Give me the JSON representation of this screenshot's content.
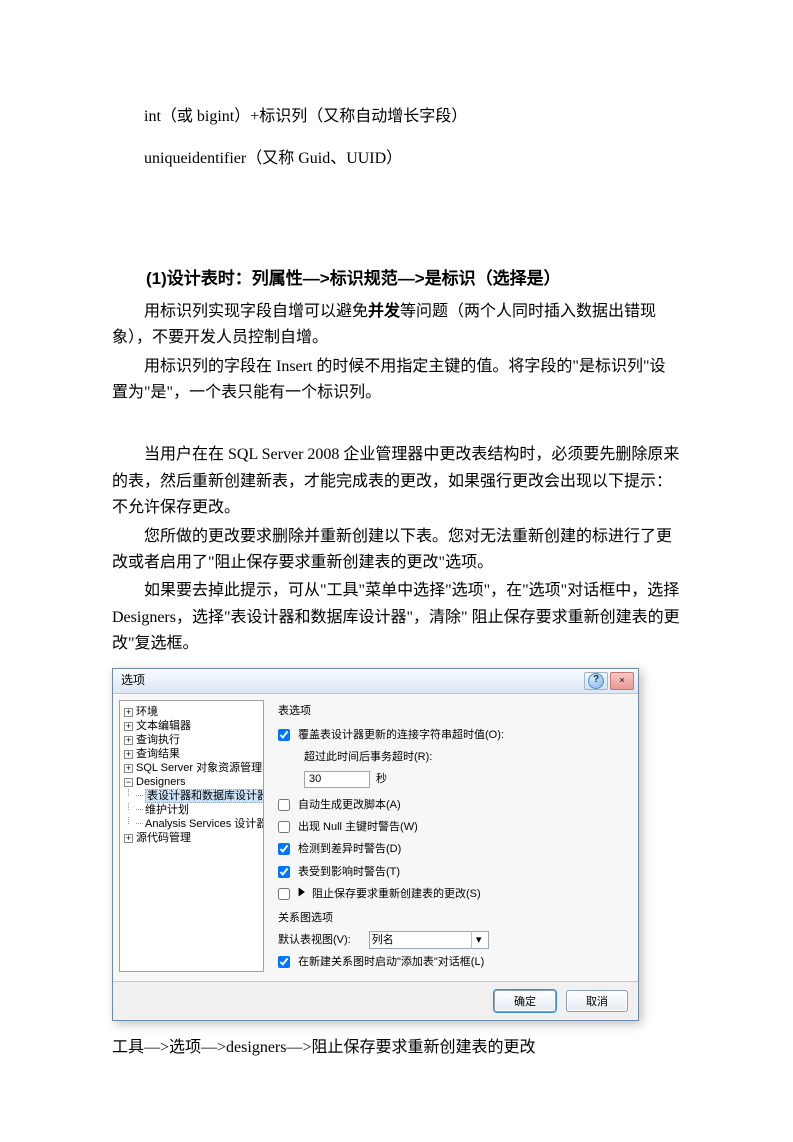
{
  "text": {
    "line1": "int（或 bigint）+标识列（又称自动增长字段）",
    "line2": "uniqueidentifier（又称 Guid、UUID）",
    "heading": "(1)设计表时：列属性—>标识规范—>是标识（选择是）",
    "p1_a": "用标识列实现字段自增可以避免",
    "p1_bold": "并发",
    "p1_b": "等问题（两个人同时插入数据出错现象），不要开发人员控制自增。",
    "p2": "用标识列的字段在 Insert 的时候不用指定主键的值。将字段的\"是标识列\"设置为\"是\"，一个表只能有一个标识列。",
    "p3": "当用户在在 SQL Server 2008 企业管理器中更改表结构时，必须要先删除原来的表，然后重新创建新表，才能完成表的更改，如果强行更改会出现以下提示：不允许保存更改。",
    "p4": "您所做的更改要求删除并重新创建以下表。您对无法重新创建的标进行了更改或者启用了\"阻止保存要求重新创建表的更改\"选项。",
    "p5": "如果要去掉此提示，可从\"工具\"菜单中选择\"选项\"，在\"选项\"对话框中，选择 Designers，选择\"表设计器和数据库设计器\"，清除\" 阻止保存要求重新创建表的更改\"复选框。",
    "caption": "工具—>选项—>designers—>阻止保存要求重新创建表的更改"
  },
  "dialog": {
    "title": "选项",
    "help": "?",
    "close": "×",
    "tree": {
      "n0": "环境",
      "n1": "文本编辑器",
      "n2": "查询执行",
      "n3": "查询结果",
      "n4": "SQL Server 对象资源管理器",
      "n5": "Designers",
      "n5a": "表设计器和数据库设计器",
      "n5b": "维护计划",
      "n5c": "Analysis Services 设计器",
      "n6": "源代码管理"
    },
    "opts": {
      "section": "表选项",
      "cb_override": "覆盖表设计器更新的连接字符串超时值(O):",
      "timeout_label": "超过此时间后事务超时(R):",
      "timeout_value": "30",
      "timeout_unit": "秒",
      "cb_autoscript": "自动生成更改脚本(A)",
      "cb_nullpk": "出现 Null 主键时警告(W)",
      "cb_diff": "检测到差异时警告(D)",
      "cb_affected": "表受到影响时警告(T)",
      "cb_prevent": "阻止保存要求重新创建表的更改(S)",
      "diagram_section": "关系图选项",
      "default_view_label": "默认表视图(V):",
      "default_view_value": "列名",
      "cb_addtable": "在新建关系图时启动\"添加表\"对话框(L)"
    },
    "buttons": {
      "ok": "确定",
      "cancel": "取消"
    }
  }
}
